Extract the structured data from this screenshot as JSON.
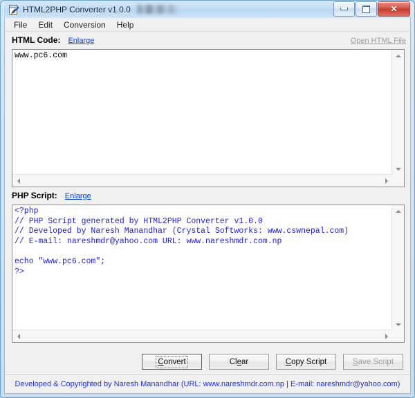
{
  "window": {
    "title": "HTML2PHP Converter v1.0.0",
    "icon": "document-pen-icon",
    "minimize_label": "Minimize",
    "maximize_label": "Maximize",
    "close_label": "✕"
  },
  "menubar": {
    "items": [
      {
        "label": "File"
      },
      {
        "label": "Edit"
      },
      {
        "label": "Conversion"
      },
      {
        "label": "Help"
      }
    ]
  },
  "html_section": {
    "label": "HTML Code:",
    "enlarge_link": "Enlarge",
    "open_file_link": "Open HTML File",
    "code": "www.pc6.com"
  },
  "php_section": {
    "label": "PHP Script:",
    "enlarge_link": "Enlarge",
    "code": "<?php\n// PHP Script generated by HTML2PHP Converter v1.0.0\n// Developed by Naresh Manandhar (Crystal Softworks: www.cswnepal.com)\n// E-mail: nareshmdr@yahoo.com URL: www.nareshmdr.com.np\n\necho \"www.pc6.com\";\n?>"
  },
  "buttons": [
    {
      "mnemonic": "C",
      "rest": "onvert",
      "name": "convert-button",
      "state": "default"
    },
    {
      "pre": "Cl",
      "mnemonic": "e",
      "rest": "ar",
      "name": "clear-button",
      "state": "normal"
    },
    {
      "mnemonic": "C",
      "rest": "opy Script",
      "name": "copy-script-button",
      "state": "normal"
    },
    {
      "mnemonic": "S",
      "rest": "ave Script",
      "name": "save-script-button",
      "state": "disabled"
    }
  ],
  "statusbar": {
    "text": "Developed & Copyrighted by Naresh Manandhar (URL: www.nareshmdr.com.np  |  E-mail: nareshmdr@yahoo.com)"
  },
  "colors": {
    "php_text": "#2222cc",
    "link": "#0b43c4",
    "status_text": "#2233cc",
    "title_bar": "#c2ddf4",
    "close_button": "#c33c2e"
  }
}
